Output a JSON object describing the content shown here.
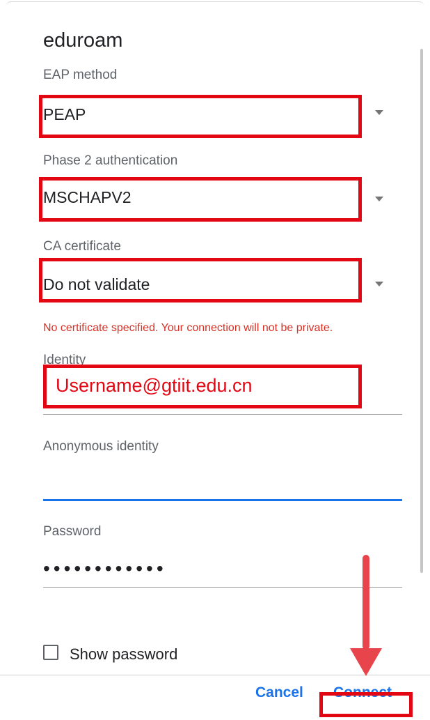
{
  "dialog": {
    "title": "eduroam",
    "eap_method": {
      "label": "EAP method",
      "value": "PEAP"
    },
    "phase2": {
      "label": "Phase 2 authentication",
      "value": "MSCHAPV2"
    },
    "ca_certificate": {
      "label": "CA certificate",
      "value": "Do not validate"
    },
    "error_text": "No certificate specified. Your connection will not be private.",
    "identity": {
      "label": "Identity",
      "value": "Username@gtiit.edu.cn"
    },
    "anonymous_identity": {
      "label": "Anonymous identity",
      "value": ""
    },
    "password": {
      "label": "Password",
      "masked_value": "••••••••••••"
    },
    "show_password": {
      "label": "Show password",
      "checked": false
    },
    "buttons": {
      "cancel": "Cancel",
      "connect": "Connect"
    }
  },
  "colors": {
    "accent": "#1a73e8",
    "error": "#d93025",
    "highlight_box": "#e30613",
    "arrow": "#e8444c"
  },
  "icons": [
    "dropdown-caret-icon",
    "checkbox-icon",
    "down-arrow-annotation"
  ]
}
